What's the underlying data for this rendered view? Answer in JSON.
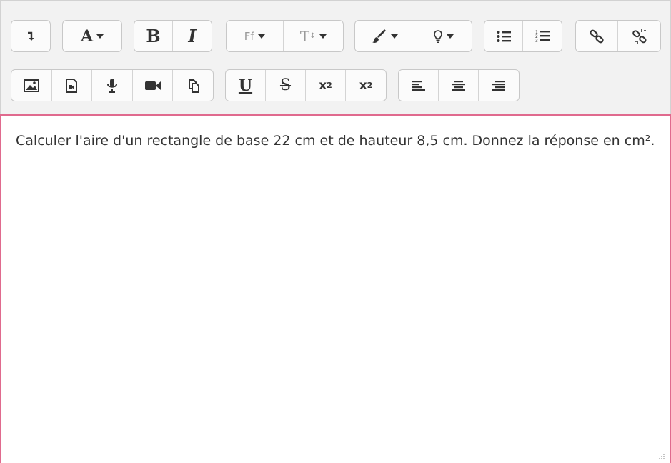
{
  "toolbar": {
    "row1": [
      {
        "name": "show-more-buttons",
        "icon": "collapse-arrow-icon"
      },
      {
        "name": "text-style",
        "label": "A",
        "icon": "caret-down-icon"
      },
      {
        "name": "bold",
        "label": "B"
      },
      {
        "name": "italic",
        "label": "I"
      },
      {
        "name": "font-family",
        "label": "Ff",
        "icon": "caret-down-icon"
      },
      {
        "name": "font-size",
        "label": "T",
        "icon": "caret-down-icon"
      },
      {
        "name": "text-color",
        "icon": "paintbrush-icon"
      },
      {
        "name": "background-color",
        "icon": "lightbulb-icon"
      },
      {
        "name": "unordered-list",
        "icon": "bullet-list-icon"
      },
      {
        "name": "ordered-list",
        "icon": "numbered-list-icon"
      },
      {
        "name": "link",
        "icon": "link-icon"
      },
      {
        "name": "unlink",
        "icon": "unlink-icon"
      }
    ],
    "row2": [
      {
        "name": "image",
        "icon": "image-icon"
      },
      {
        "name": "media",
        "icon": "file-media-icon"
      },
      {
        "name": "record-audio",
        "icon": "microphone-icon"
      },
      {
        "name": "record-video",
        "icon": "video-camera-icon"
      },
      {
        "name": "manage-files",
        "icon": "copy-files-icon"
      },
      {
        "name": "underline",
        "label": "U"
      },
      {
        "name": "strikethrough",
        "label": "S"
      },
      {
        "name": "subscript",
        "label": "x",
        "sub": "2"
      },
      {
        "name": "superscript",
        "label": "x",
        "sup": "2"
      },
      {
        "name": "align-left",
        "icon": "align-left-icon"
      },
      {
        "name": "align-center",
        "icon": "align-center-icon"
      },
      {
        "name": "align-right",
        "icon": "align-right-icon"
      }
    ]
  },
  "content": {
    "text": "Calculer l'aire d'un rectangle de base 22 cm et de hauteur 8,5 cm. Donnez la réponse en cm²."
  },
  "colors": {
    "toolbar_bg": "#f2f2f2",
    "focus_border": "#e06a8e"
  }
}
